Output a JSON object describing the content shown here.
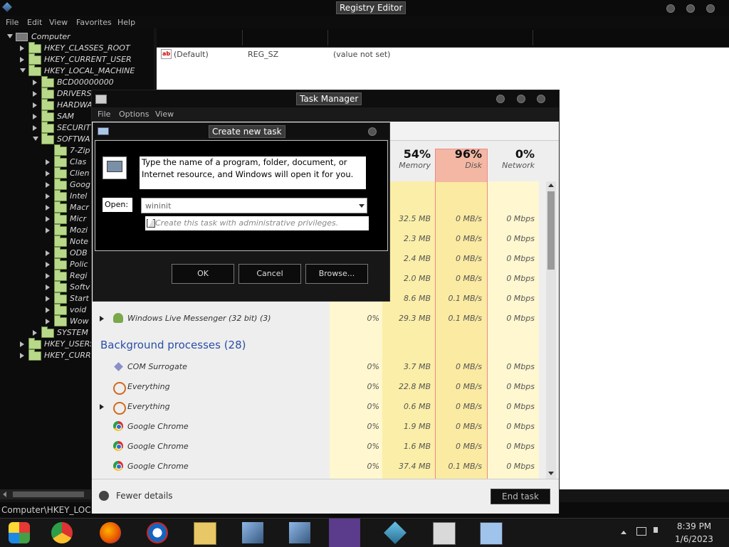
{
  "registry_editor": {
    "title": "Registry Editor",
    "menu": [
      "File",
      "Edit",
      "View",
      "Favorites",
      "Help"
    ],
    "tree": [
      {
        "label": "Computer",
        "level": 0,
        "expander": "down",
        "icon": "computer"
      },
      {
        "label": "HKEY_CLASSES_ROOT",
        "level": 1,
        "expander": "right",
        "icon": "folder"
      },
      {
        "label": "HKEY_CURRENT_USER",
        "level": 1,
        "expander": "right",
        "icon": "folder"
      },
      {
        "label": "HKEY_LOCAL_MACHINE",
        "level": 1,
        "expander": "down",
        "icon": "folder"
      },
      {
        "label": "BCD00000000",
        "level": 2,
        "expander": "right",
        "icon": "folder"
      },
      {
        "label": "DRIVERS",
        "level": 2,
        "expander": "right",
        "icon": "folder"
      },
      {
        "label": "HARDWA",
        "level": 2,
        "expander": "right",
        "icon": "folder"
      },
      {
        "label": "SAM",
        "level": 2,
        "expander": "right",
        "icon": "folder"
      },
      {
        "label": "SECURIT",
        "level": 2,
        "expander": "right",
        "icon": "folder"
      },
      {
        "label": "SOFTWA",
        "level": 2,
        "expander": "down",
        "icon": "folder"
      },
      {
        "label": "7-Zip",
        "level": 3,
        "expander": "none",
        "icon": "folder"
      },
      {
        "label": "Clas",
        "level": 3,
        "expander": "right",
        "icon": "folder"
      },
      {
        "label": "Clien",
        "level": 3,
        "expander": "right",
        "icon": "folder"
      },
      {
        "label": "Goog",
        "level": 3,
        "expander": "right",
        "icon": "folder"
      },
      {
        "label": "Intel",
        "level": 3,
        "expander": "right",
        "icon": "folder"
      },
      {
        "label": "Macr",
        "level": 3,
        "expander": "right",
        "icon": "folder"
      },
      {
        "label": "Micr",
        "level": 3,
        "expander": "right",
        "icon": "folder"
      },
      {
        "label": "Mozi",
        "level": 3,
        "expander": "right",
        "icon": "folder"
      },
      {
        "label": "Note",
        "level": 3,
        "expander": "none",
        "icon": "folder"
      },
      {
        "label": "ODB",
        "level": 3,
        "expander": "right",
        "icon": "folder"
      },
      {
        "label": "Polic",
        "level": 3,
        "expander": "right",
        "icon": "folder"
      },
      {
        "label": "Regi",
        "level": 3,
        "expander": "right",
        "icon": "folder"
      },
      {
        "label": "Softv",
        "level": 3,
        "expander": "right",
        "icon": "folder"
      },
      {
        "label": "Start",
        "level": 3,
        "expander": "right",
        "icon": "folder"
      },
      {
        "label": "void",
        "level": 3,
        "expander": "right",
        "icon": "folder"
      },
      {
        "label": "Wow",
        "level": 3,
        "expander": "right",
        "icon": "folder"
      },
      {
        "label": "SYSTEM",
        "level": 2,
        "expander": "right",
        "icon": "folder"
      },
      {
        "label": "HKEY_USERS",
        "level": 1,
        "expander": "right",
        "icon": "folder"
      },
      {
        "label": "HKEY_CURR",
        "level": 1,
        "expander": "right",
        "icon": "folder"
      }
    ],
    "values": [
      {
        "name": "(Default)",
        "type": "REG_SZ",
        "data": "(value not set)"
      }
    ],
    "status_path": "Computer\\HKEY_LOCAL"
  },
  "task_manager": {
    "title": "Task Manager",
    "menu": [
      "File",
      "Options",
      "View"
    ],
    "columns": [
      {
        "pct": "54%",
        "label": "Memory"
      },
      {
        "pct": "96%",
        "label": "Disk"
      },
      {
        "pct": "0%",
        "label": "Network"
      }
    ],
    "app_rows": [
      {
        "name": "",
        "cpu": "",
        "mem": "32.5 MB",
        "disk": "0 MB/s",
        "net": "0 Mbps"
      },
      {
        "name": "",
        "cpu": "",
        "mem": "2.3 MB",
        "disk": "0 MB/s",
        "net": "0 Mbps"
      },
      {
        "name": "",
        "cpu": "",
        "mem": "2.4 MB",
        "disk": "0 MB/s",
        "net": "0 Mbps"
      },
      {
        "name": "",
        "cpu": "",
        "mem": "2.0 MB",
        "disk": "0 MB/s",
        "net": "0 Mbps"
      },
      {
        "name": "",
        "cpu": "",
        "mem": "8.6 MB",
        "disk": "0.1 MB/s",
        "net": "0 Mbps"
      },
      {
        "name": "Windows Live Messenger (32 bit) (3)",
        "cpu": "0%",
        "mem": "29.3 MB",
        "disk": "0.1 MB/s",
        "net": "0 Mbps",
        "icon": "messenger-icon",
        "expandable": true
      }
    ],
    "background_header": "Background processes (28)",
    "bg_rows": [
      {
        "name": "COM Surrogate",
        "cpu": "0%",
        "mem": "3.7 MB",
        "disk": "0 MB/s",
        "net": "0 Mbps",
        "icon": "com-surrogate-icon",
        "expandable": false
      },
      {
        "name": "Everything",
        "cpu": "0%",
        "mem": "22.8 MB",
        "disk": "0 MB/s",
        "net": "0 Mbps",
        "icon": "everything-icon",
        "expandable": false
      },
      {
        "name": "Everything",
        "cpu": "0%",
        "mem": "0.6 MB",
        "disk": "0 MB/s",
        "net": "0 Mbps",
        "icon": "everything-icon",
        "expandable": true
      },
      {
        "name": "Google Chrome",
        "cpu": "0%",
        "mem": "1.9 MB",
        "disk": "0 MB/s",
        "net": "0 Mbps",
        "icon": "chrome-icon",
        "expandable": false
      },
      {
        "name": "Google Chrome",
        "cpu": "0%",
        "mem": "1.6 MB",
        "disk": "0 MB/s",
        "net": "0 Mbps",
        "icon": "chrome-icon",
        "expandable": false
      },
      {
        "name": "Google Chrome",
        "cpu": "0%",
        "mem": "37.4 MB",
        "disk": "0.1 MB/s",
        "net": "0 Mbps",
        "icon": "chrome-icon",
        "expandable": false
      }
    ],
    "fewer_details": "Fewer details",
    "end_task": "End task"
  },
  "create_task": {
    "title": "Create new task",
    "message_line1": "Type the name of a program, folder, document, or",
    "message_line2": "Internet resource, and Windows will open it for you.",
    "open_label": "Open:",
    "open_value": "wininit",
    "admin_label": "Create this task with administrative privileges.",
    "ok": "OK",
    "cancel": "Cancel",
    "browse": "Browse..."
  },
  "taskbar": {
    "icons": [
      "start-icon",
      "chrome-icon",
      "firefox-icon",
      "obama-logo-icon",
      "file-explorer-icon",
      "registry-icon",
      "registry-icon-2",
      "messenger-icon",
      "cube-app-icon",
      "task-manager-icon",
      "run-dialog-icon"
    ],
    "time": "8:39 PM",
    "date": "1/6/2023"
  }
}
